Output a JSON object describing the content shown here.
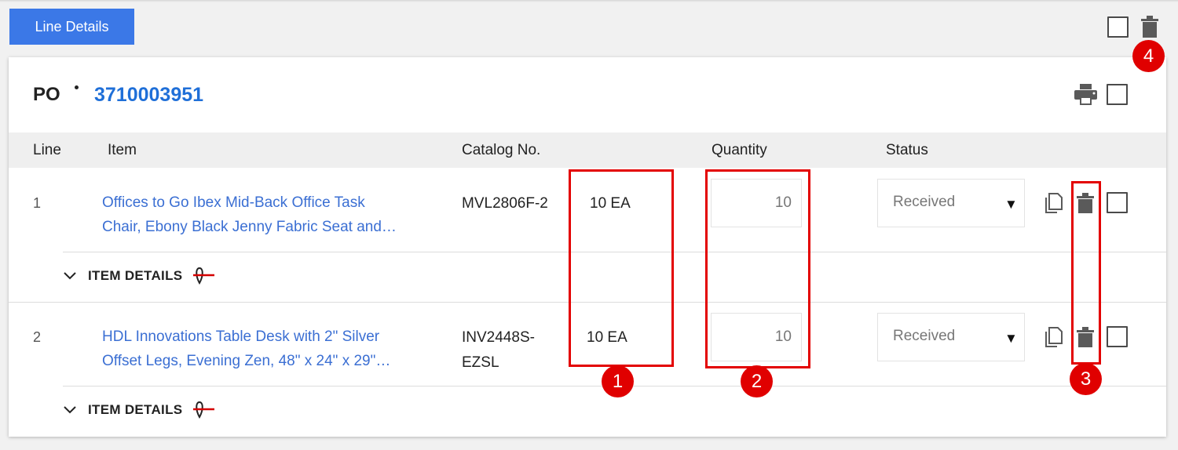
{
  "tab": {
    "label": "Line Details"
  },
  "po": {
    "label": "PO",
    "number": "3710003951"
  },
  "columns": {
    "line": "Line",
    "item": "Item",
    "catalog": "Catalog No.",
    "quantity": "Quantity",
    "status": "Status"
  },
  "rows": [
    {
      "line": "1",
      "item_line1": "Offices to Go Ibex Mid-Back Office Task",
      "item_line2": "Chair, Ebony Black Jenny Fabric Seat and…",
      "catalog_line1": "MVL2806F-2",
      "catalog_line2": "",
      "ordered": "10 EA",
      "quantity": "10",
      "status": "Received",
      "details_label": "ITEM DETAILS"
    },
    {
      "line": "2",
      "item_line1": "HDL Innovations Table Desk with 2\" Silver",
      "item_line2": "Offset Legs, Evening Zen, 48\" x 24\" x 29\"…",
      "catalog_line1": "INV2448S-",
      "catalog_line2": "EZSL",
      "ordered": "10 EA",
      "quantity": "10",
      "status": "Received",
      "details_label": "ITEM DETAILS"
    }
  ],
  "annotations": [
    "1",
    "2",
    "3",
    "4"
  ],
  "colors": {
    "accent": "#3b78e7",
    "link": "#3b6fd3",
    "annotation": "#e30000"
  },
  "icons": [
    "trash-icon",
    "print-icon",
    "copy-icon",
    "chevron-down-icon",
    "location-icon",
    "dropdown-arrow-icon"
  ]
}
